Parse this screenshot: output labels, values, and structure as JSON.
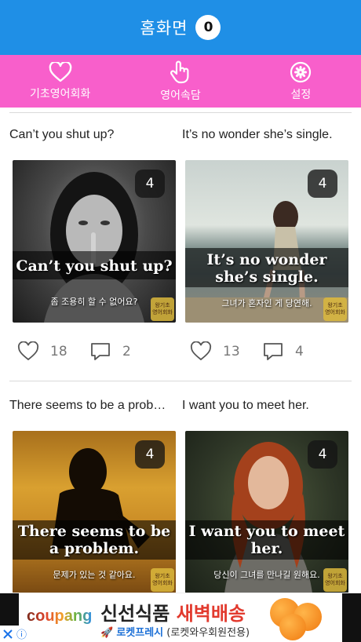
{
  "header": {
    "title": "홈화면",
    "count": "0"
  },
  "nav": [
    {
      "label": "기초영어회화",
      "icon": "heart-icon"
    },
    {
      "label": "영어속담",
      "icon": "hand-pointer-icon"
    },
    {
      "label": "설정",
      "icon": "gear-icon"
    }
  ],
  "cards": [
    {
      "caption": "Can’t you shut up?",
      "badge": "4",
      "overlay_en": "Can’t you shut up?",
      "overlay_ko": "좀 조용히 할 수 없어요?",
      "logo": "왕기초\n영어회화",
      "likes": "18",
      "comments": "2"
    },
    {
      "caption": "It’s no wonder she’s single.",
      "badge": "4",
      "overlay_en": "It’s no wonder she’s single.",
      "overlay_ko": "그녀가 혼자인 게 당연해.",
      "logo": "왕기초\n영어회화",
      "likes": "13",
      "comments": "4"
    },
    {
      "caption": "There seems to be a prob…",
      "badge": "4",
      "overlay_en": "There seems to be a problem.",
      "overlay_ko": "문제가 있는 것 같아요.",
      "logo": "왕기초\n영어회화",
      "likes": "",
      "comments": ""
    },
    {
      "caption": "I want you to meet her.",
      "badge": "4",
      "overlay_en": "I want you to meet her.",
      "overlay_ko": "당신이 그녀를 만나길 원해요.",
      "logo": "왕기초\n영어회화",
      "likes": "",
      "comments": ""
    }
  ],
  "ad": {
    "brand": "coupang",
    "headline_a": "신선식품 ",
    "headline_b": "새벽배송",
    "sub_a": "로켓프레시",
    "sub_b": " (로켓와우회원전용)",
    "ad_choices": "ⓘ"
  },
  "colors": {
    "header": "#1f8fe6",
    "nav": "#f85fcb",
    "accent_red": "#e23a2e"
  }
}
